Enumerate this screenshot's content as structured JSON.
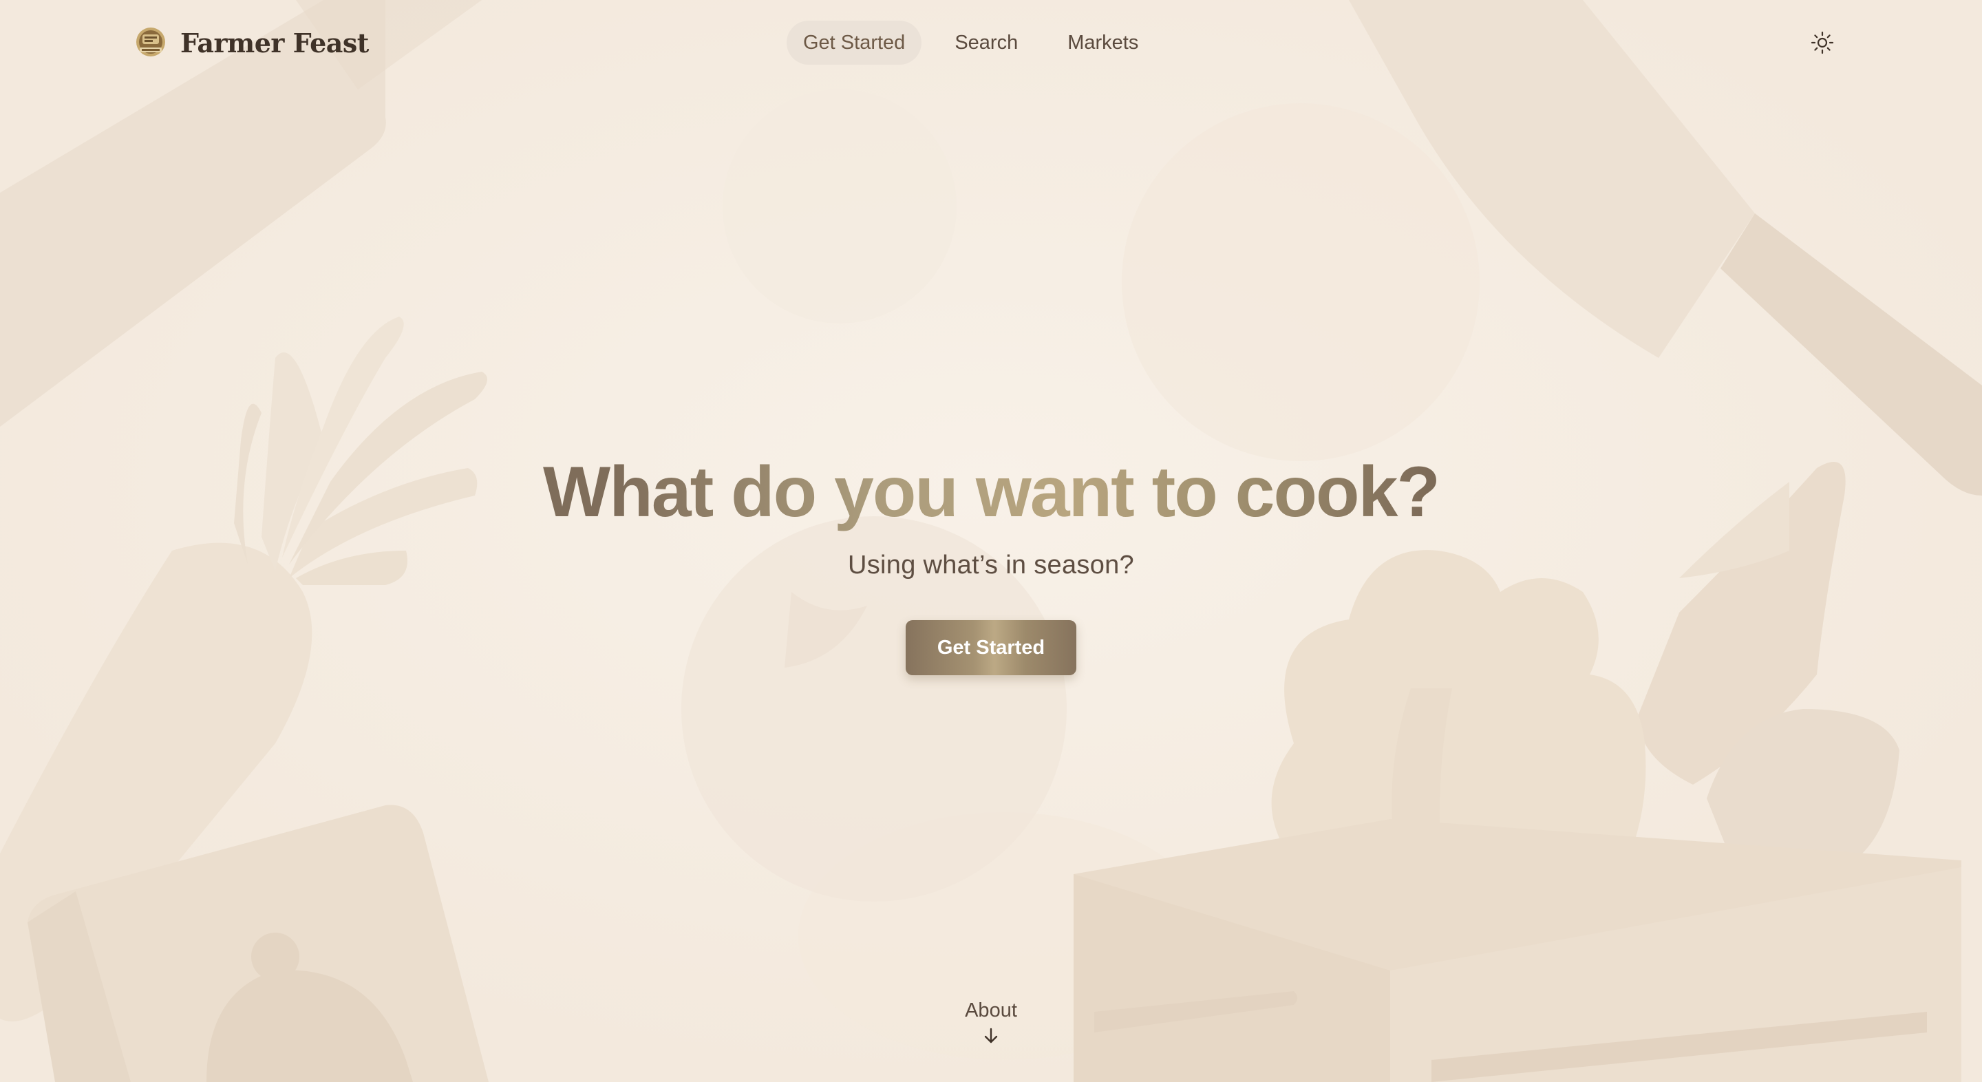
{
  "brand": {
    "name": "Farmer Feast",
    "logo_icon": "farmer-feast-badge-icon"
  },
  "nav": {
    "items": [
      {
        "label": "Get Started",
        "active": true
      },
      {
        "label": "Search",
        "active": false
      },
      {
        "label": "Markets",
        "active": false
      }
    ]
  },
  "header": {
    "theme_toggle_icon": "sun-icon"
  },
  "hero": {
    "title": "What do you want to cook?",
    "subtitle": "Using what’s in season?",
    "cta_label": "Get Started"
  },
  "footer_link": {
    "label": "About",
    "icon": "arrow-down-icon"
  },
  "colors": {
    "background": "#f6eee4",
    "text_dark": "#3f3228",
    "accent_gold": "#b8a57f",
    "accent_brown": "#7b6a58",
    "nav_active_bg": "#ebe2d8"
  }
}
